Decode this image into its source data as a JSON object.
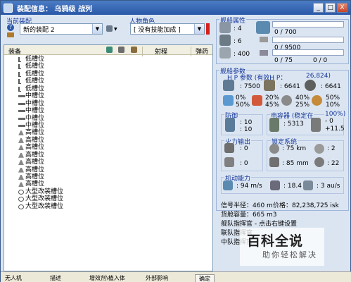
{
  "window": {
    "title": "装配信息： 乌鸦级 战列",
    "minimize": "_",
    "maximize": "□",
    "close": "X"
  },
  "left": {
    "current_fitting_label": "当前装配",
    "fitting_value": "新的装配 2",
    "character_label": "人物角色",
    "character_value": "[ 没有技能加成 ]",
    "columns": {
      "equipment": "装备",
      "range": "射程",
      "ammo": "弹药"
    },
    "rows": [
      {
        "type": "low",
        "label": "低槽位"
      },
      {
        "type": "low",
        "label": "低槽位"
      },
      {
        "type": "low",
        "label": "低槽位"
      },
      {
        "type": "low",
        "label": "低槽位"
      },
      {
        "type": "low",
        "label": "低槽位"
      },
      {
        "type": "mid",
        "label": "中槽位"
      },
      {
        "type": "mid",
        "label": "中槽位"
      },
      {
        "type": "mid",
        "label": "中槽位"
      },
      {
        "type": "mid",
        "label": "中槽位"
      },
      {
        "type": "mid",
        "label": "中槽位"
      },
      {
        "type": "high",
        "label": "高槽位"
      },
      {
        "type": "high",
        "label": "高槽位"
      },
      {
        "type": "high",
        "label": "高槽位"
      },
      {
        "type": "high",
        "label": "高槽位"
      },
      {
        "type": "high",
        "label": "高槽位"
      },
      {
        "type": "high",
        "label": "高槽位"
      },
      {
        "type": "high",
        "label": "高槽位"
      },
      {
        "type": "high",
        "label": "高槽位"
      },
      {
        "type": "rig",
        "label": "大型改装槽位"
      },
      {
        "type": "rig",
        "label": "大型改装槽位"
      },
      {
        "type": "rig",
        "label": "大型改装槽位"
      }
    ],
    "bottom_tabs": [
      "无人机",
      "描述",
      "增效剂\\植入体",
      "外部影响",
      "确定"
    ]
  },
  "right": {
    "ship_attr": {
      "title": "舰船属性",
      "turret": ": 4",
      "launcher": ": 6",
      "drone_bw": ": 400",
      "cpu": "0 / 700",
      "power": "0 / 9500",
      "calibration": "0 / 75",
      "drone_bay": "0 / 0"
    },
    "ship_params": {
      "title": "舰船参数",
      "hp_label": "H P 参数 (有效H P：",
      "ehp": "26,824)",
      "shield_hp": ": 7500",
      "armor_hp": ": 6641",
      "hull_hp": ": 6641",
      "res1": [
        "0%",
        "50%"
      ],
      "res2": [
        "20%",
        "45%"
      ],
      "res3": [
        "40%",
        "25%"
      ],
      "res4": [
        "50%",
        "10%"
      ]
    },
    "defense": {
      "title": "防御",
      "v1": ": 10",
      "v2": ": 10"
    },
    "cap": {
      "title": "电容器 (稳定在",
      "stable": "100%)",
      "amount": ": 5313",
      "delta1": "- 0",
      "delta2": "+11.5"
    },
    "fire": {
      "title": "火力输出",
      "v1": ": 0",
      "v2": ": 0"
    },
    "lock": {
      "title": "锁定系统",
      "range": ": 75 km",
      "targets": ": 2",
      "res": ": 85 mm",
      "sig": ": 22"
    },
    "nav": {
      "title": "机动能力",
      "speed": ": 94 m/s",
      "agility": ": 18.4 s",
      "warp": ": 3 au/s"
    },
    "info": {
      "sig_radius": "信号半径：460 m",
      "price": "价格：82,238,725 isk",
      "cargo": "货舱容量：665 m3",
      "fleet_cmd": "舰队指挥官 - 点击右键设置",
      "wing_cmd": "联队指挥官",
      "squad_cmd": "中队指挥官"
    }
  },
  "watermark": {
    "line1": "百科全说",
    "line2": "助你轻松解决"
  }
}
